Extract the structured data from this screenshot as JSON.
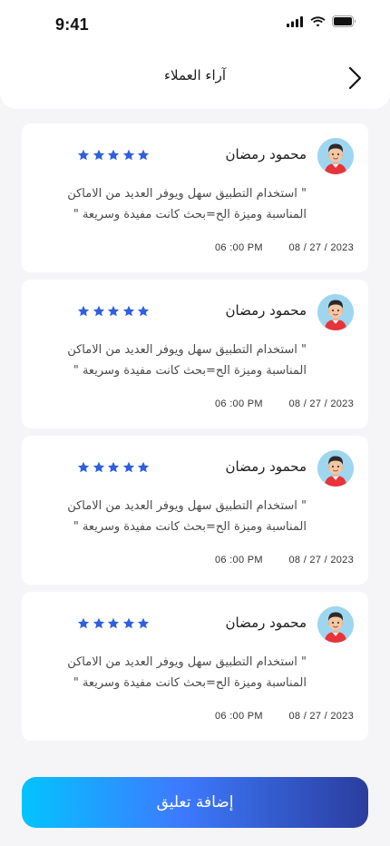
{
  "status_bar": {
    "time": "9:41",
    "icons": [
      "signal-icon",
      "wifi-icon",
      "battery-icon"
    ]
  },
  "header": {
    "title": "آراء العملاء",
    "back_icon": "chevron-right-icon"
  },
  "reviews": [
    {
      "name": "محمود رمضان",
      "rating": 5,
      "text": "\" استخدام التطبيق سهل ويوفر العديد من الاماكن المناسبة وميزة الح=بحث كانت مفيدة وسريعة \"",
      "date": "08 / 27 / 2023",
      "time": "06 :00 PM"
    },
    {
      "name": "محمود رمضان",
      "rating": 5,
      "text": "\" استخدام التطبيق سهل ويوفر العديد من الاماكن المناسبة وميزة الح=بحث كانت مفيدة وسريعة \"",
      "date": "08 / 27 / 2023",
      "time": "06 :00 PM"
    },
    {
      "name": "محمود رمضان",
      "rating": 5,
      "text": "\" استخدام التطبيق سهل ويوفر العديد من الاماكن المناسبة وميزة الح=بحث كانت مفيدة وسريعة \"",
      "date": "08 / 27 / 2023",
      "time": "06 :00 PM"
    },
    {
      "name": "محمود رمضان",
      "rating": 5,
      "text": "\" استخدام التطبيق سهل ويوفر العديد من الاماكن المناسبة وميزة الح=بحث كانت مفيدة وسريعة \"",
      "date": "08 / 27 / 2023",
      "time": "06 :00 PM"
    }
  ],
  "add_button": {
    "label": "إضافة تعليق"
  },
  "colors": {
    "star": "#2f5fe0",
    "button_start": "#03c3ff",
    "button_end": "#2b3d9e",
    "background": "#f5f5f7"
  }
}
